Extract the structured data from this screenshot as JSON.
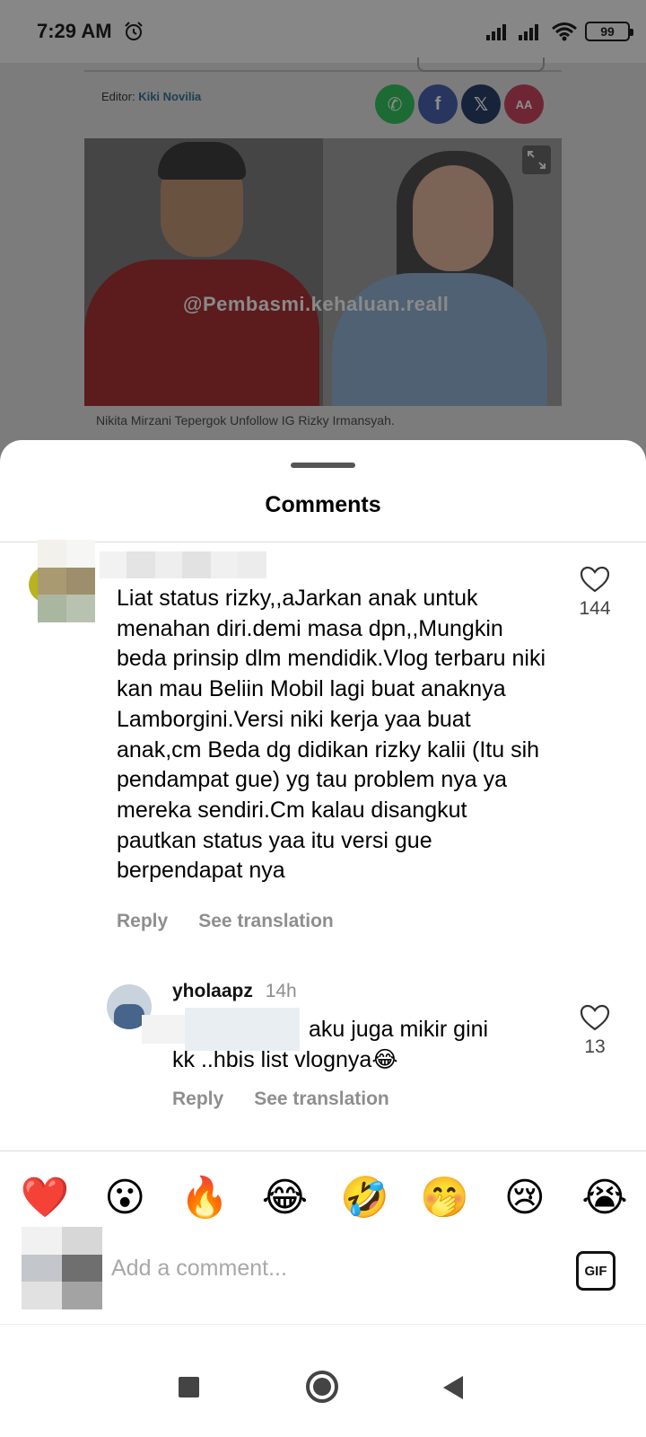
{
  "status_bar": {
    "time": "7:29 AM",
    "battery": "99",
    "icons": [
      "alarm-icon",
      "signal-icon",
      "signal-icon",
      "wifi-icon",
      "battery-icon"
    ]
  },
  "article": {
    "editor_label": "Editor:",
    "editor_name": "Kiki Novilia",
    "share_buttons": [
      {
        "icon": "whatsapp-icon",
        "label": "✆"
      },
      {
        "icon": "facebook-icon",
        "label": "f"
      },
      {
        "icon": "x-icon",
        "label": "𝕏"
      },
      {
        "icon": "font-size-icon",
        "label": "AA"
      }
    ],
    "photo_watermark": "@Pembasmi.kehaluan.reall",
    "caption": "Nikita Mirzani Tepergok Unfollow IG Rizky Irmansyah."
  },
  "sheet": {
    "title": "Comments",
    "comments": [
      {
        "text": "Liat status rizky,,aJarkan anak untuk menahan diri.demi masa dpn,,Mungkin beda prinsip dlm mendidik.Vlog terbaru niki kan mau Beliin Mobil lagi buat anaknya Lamborgini.Versi niki kerja yaa buat anak,cm Beda dg didikan rizky kalii (Itu sih pendampat gue) yg tau problem nya ya mereka sendiri.Cm kalau disangkut pautkan status yaa itu versi gue berpendapat nya",
        "likes": "144",
        "reply_label": "Reply",
        "translate_label": "See translation"
      }
    ],
    "replies": [
      {
        "username": "yholaapz",
        "time": "14h",
        "text_line1": "aku juga mikir gini",
        "text_line2": "kk ..hbis list vlognya😂",
        "likes": "13",
        "reply_label": "Reply",
        "translate_label": "See translation"
      }
    ],
    "reactions": [
      {
        "name": "heart-emoji",
        "glyph": "❤️"
      },
      {
        "name": "surprised-emoji",
        "glyph": "😮"
      },
      {
        "name": "fire-emoji",
        "glyph": "🔥"
      },
      {
        "name": "joy-emoji",
        "glyph": "😂"
      },
      {
        "name": "rofl-emoji",
        "glyph": "🤣"
      },
      {
        "name": "hand-over-mouth-emoji",
        "glyph": "🤭"
      },
      {
        "name": "sad-emoji",
        "glyph": "😢"
      },
      {
        "name": "sob-emoji",
        "glyph": "😭"
      }
    ],
    "input_placeholder": "Add a comment...",
    "gif_label": "GIF"
  },
  "nav": {
    "icons": [
      "recent-apps-icon",
      "home-icon",
      "back-icon"
    ]
  }
}
